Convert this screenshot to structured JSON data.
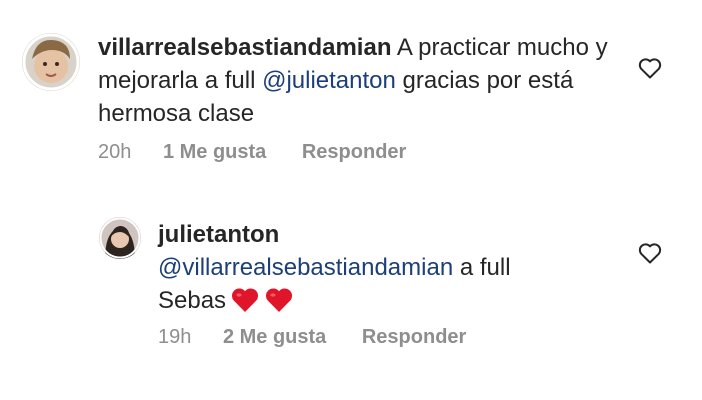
{
  "comments": [
    {
      "username": "villarrealsebastiandamian",
      "text_before": "A practicar mucho y mejorarla a full",
      "mention": "@julietanton",
      "text_after": "gracias por está hermosa clase",
      "time": "20h",
      "likes": "1 Me gusta",
      "reply_label": "Responder",
      "like_icon": "heart-outline-icon"
    }
  ],
  "reply": {
    "username": "julietanton",
    "mention": "@villarrealsebastiandamian",
    "text_after": "a full",
    "text_line2": "Sebas",
    "emojis": [
      "red-heart-emoji",
      "red-heart-emoji"
    ],
    "time": "19h",
    "likes": "2 Me gusta",
    "reply_label": "Responder",
    "like_icon": "heart-outline-icon"
  },
  "colors": {
    "mention": "#1c3f7a",
    "meta": "#8e8e8e",
    "text": "#262626",
    "emoji_heart": "#e0152a"
  }
}
